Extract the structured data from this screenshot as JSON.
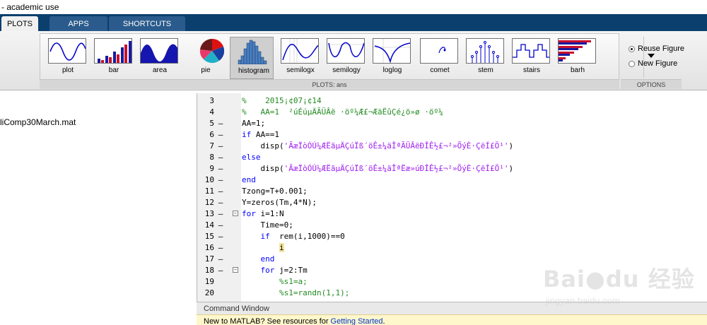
{
  "window": {
    "title": "- academic use"
  },
  "tabs": [
    {
      "label": "PLOTS",
      "active": true
    },
    {
      "label": "APPS",
      "active": false
    },
    {
      "label": "SHORTCUTS",
      "active": false
    }
  ],
  "plots": [
    {
      "label": "plot",
      "icon": "plot-icon"
    },
    {
      "label": "bar",
      "icon": "bar-chart-icon"
    },
    {
      "label": "area",
      "icon": "area-chart-icon"
    },
    {
      "label": "pie",
      "icon": "pie-chart-icon"
    },
    {
      "label": "histogram",
      "icon": "histogram-icon",
      "selected": true
    },
    {
      "label": "semilogx",
      "icon": "semilogx-icon"
    },
    {
      "label": "semilogy",
      "icon": "semilogy-icon"
    },
    {
      "label": "loglog",
      "icon": "loglog-icon"
    },
    {
      "label": "comet",
      "icon": "comet-icon"
    },
    {
      "label": "stem",
      "icon": "stem-icon"
    },
    {
      "label": "stairs",
      "icon": "stairs-icon"
    },
    {
      "label": "barh",
      "icon": "barh-icon"
    }
  ],
  "ribbon": {
    "section_label": "PLOTS: ans",
    "options_label": "OPTIONS"
  },
  "options": [
    {
      "label": "Reuse Figure",
      "checked": true
    },
    {
      "label": "New Figure",
      "checked": false
    }
  ],
  "workspace": {
    "file": "liComp30March.mat"
  },
  "editor": {
    "lines": [
      {
        "n": "3",
        "marker": "",
        "fold": "",
        "parts": [
          {
            "t": "%    2015¡¢07¡¢14",
            "c": "cm"
          }
        ]
      },
      {
        "n": "4",
        "marker": "",
        "fold": "",
        "parts": [
          {
            "t": "%   AA=1  ²úÉúµÄÃÜÂë ·öº¼Æ£¬ÆäËûÇé¿ö»ø ·öº¼",
            "c": "cm"
          }
        ]
      },
      {
        "n": "5",
        "marker": "—",
        "fold": "",
        "parts": [
          {
            "t": "AA=1;",
            "c": "pl"
          }
        ]
      },
      {
        "n": "6",
        "marker": "—",
        "fold": "",
        "parts": [
          {
            "t": "if",
            "c": "kw"
          },
          {
            "t": " AA==1",
            "c": "pl"
          }
        ]
      },
      {
        "n": "7",
        "marker": "—",
        "fold": "",
        "parts": [
          {
            "t": "    disp(",
            "c": "pl"
          },
          {
            "t": "'ÃæÏòÓÚ¼ÆËãµÄÇúÏß´öÊ±¼äÎªÃÜÂëÐÎÊ½£¬²»ÕýÈ·ÇëÍ£Ö¹'",
            "c": "str"
          },
          {
            "t": ")",
            "c": "pl"
          }
        ]
      },
      {
        "n": "8",
        "marker": "—",
        "fold": "",
        "parts": [
          {
            "t": "else",
            "c": "kw"
          }
        ]
      },
      {
        "n": "9",
        "marker": "—",
        "fold": "",
        "parts": [
          {
            "t": "    disp(",
            "c": "pl"
          },
          {
            "t": "'ÃæÏòÓÚ¼ÆËãµÄÇúÏß´öÊ±¼äÎªËæ»úÐÎÊ½£¬²»ÕýÈ·ÇëÍ£Ö¹'",
            "c": "str"
          },
          {
            "t": ")",
            "c": "pl"
          }
        ]
      },
      {
        "n": "10",
        "marker": "—",
        "fold": "",
        "parts": [
          {
            "t": "end",
            "c": "kw"
          }
        ]
      },
      {
        "n": "11",
        "marker": "—",
        "fold": "",
        "parts": [
          {
            "t": "Tzong=T+0.001;",
            "c": "pl"
          }
        ]
      },
      {
        "n": "12",
        "marker": "—",
        "fold": "",
        "parts": [
          {
            "t": "Y=zeros(Tm,4*N);",
            "c": "pl"
          }
        ]
      },
      {
        "n": "13",
        "marker": "—",
        "fold": "−",
        "parts": [
          {
            "t": "for",
            "c": "kw"
          },
          {
            "t": " i=1:N",
            "c": "pl"
          }
        ]
      },
      {
        "n": "14",
        "marker": "—",
        "fold": "",
        "parts": [
          {
            "t": "    Time=0;",
            "c": "pl"
          }
        ]
      },
      {
        "n": "15",
        "marker": "—",
        "fold": "",
        "parts": [
          {
            "t": "    ",
            "c": "pl"
          },
          {
            "t": "if",
            "c": "kw"
          },
          {
            "t": "  rem(i,1000)==0",
            "c": "pl"
          }
        ]
      },
      {
        "n": "16",
        "marker": "—",
        "fold": "",
        "parts": [
          {
            "t": "        ",
            "c": "pl"
          },
          {
            "t": "i",
            "c": "pl hl"
          }
        ]
      },
      {
        "n": "17",
        "marker": "—",
        "fold": "",
        "parts": [
          {
            "t": "    ",
            "c": "pl"
          },
          {
            "t": "end",
            "c": "kw"
          }
        ]
      },
      {
        "n": "18",
        "marker": "—",
        "fold": "−",
        "parts": [
          {
            "t": "    ",
            "c": "pl"
          },
          {
            "t": "for",
            "c": "kw"
          },
          {
            "t": " j=2:Tm",
            "c": "pl"
          }
        ]
      },
      {
        "n": "19",
        "marker": "",
        "fold": "",
        "parts": [
          {
            "t": "        %s1=a;",
            "c": "cm"
          }
        ]
      },
      {
        "n": "20",
        "marker": "",
        "fold": "",
        "parts": [
          {
            "t": "        %s1=randn(1,1);",
            "c": "cm"
          }
        ]
      }
    ]
  },
  "command_window": {
    "title": "Command Window",
    "info_prefix": "New to MATLAB? See resources for ",
    "info_link": "Getting Started",
    "info_suffix": "."
  },
  "watermark": {
    "main": "Bai●du 经验",
    "url": "jingyan.baidu.com"
  },
  "colors": {
    "tab_bar": "#0b3f6e",
    "keyword": "#0000ff",
    "comment": "#228b22",
    "string": "#a020f0"
  }
}
